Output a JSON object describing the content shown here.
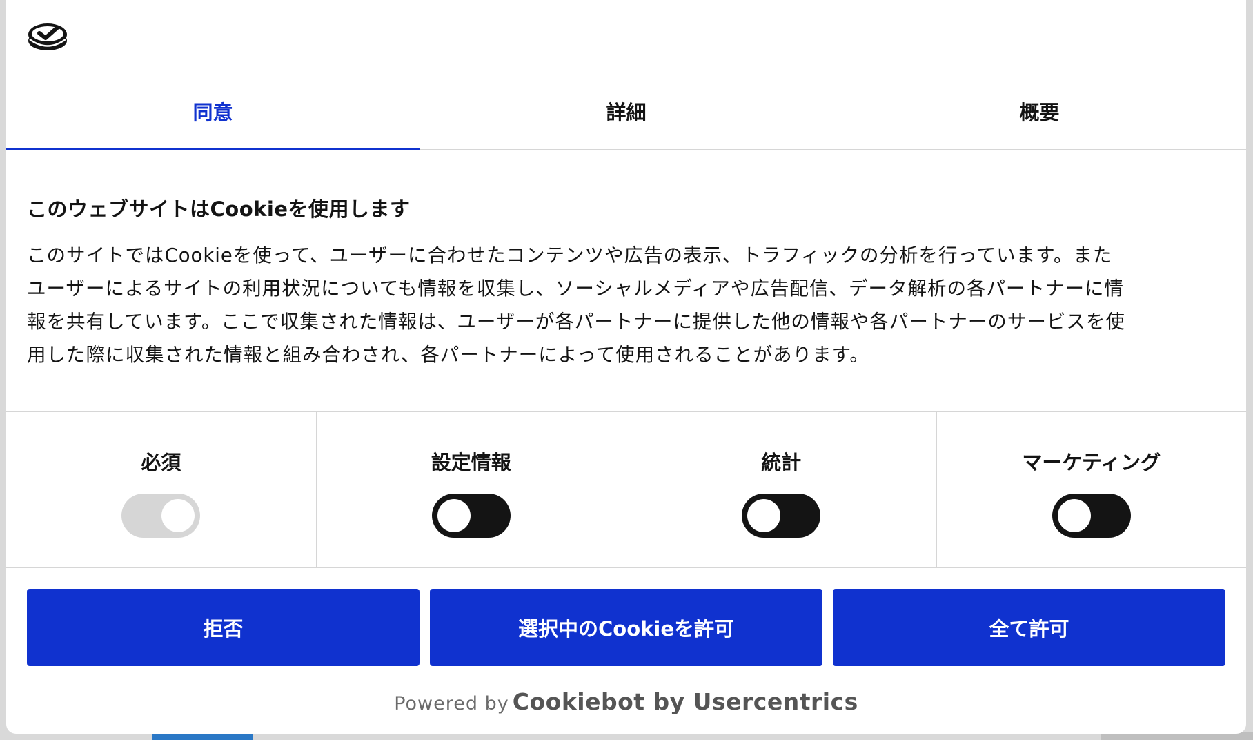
{
  "logo": {
    "icon": "cookiebot-logo-icon"
  },
  "tabs": [
    {
      "label": "同意",
      "active": true
    },
    {
      "label": "詳細",
      "active": false
    },
    {
      "label": "概要",
      "active": false
    }
  ],
  "consent": {
    "title": "このウェブサイトはCookieを使用します",
    "lines": [
      "このサイトではCookieを使って、ユーザーに合わせたコンテンツや広告の表示、トラフィックの分析を行っています。また",
      "ユーザーによるサイトの利用状況についても情報を収集し、ソーシャルメディアや広告配信、データ解析の各パートナーに情",
      "報を共有しています。ここで収集された情報は、ユーザーが各パートナーに提供した他の情報や各パートナーのサービスを使",
      "用した際に収集された情報と組み合わされ、各パートナーによって使用されることがあります。"
    ]
  },
  "categories": [
    {
      "label": "必須",
      "state": "on-disabled"
    },
    {
      "label": "設定情報",
      "state": "off"
    },
    {
      "label": "統計",
      "state": "off"
    },
    {
      "label": "マーケティング",
      "state": "off"
    }
  ],
  "buttons": {
    "deny": "拒否",
    "allow_selection": "選択中のCookieを許可",
    "allow_all": "全て許可"
  },
  "footer": {
    "powered_by": "Powered by",
    "brand": "Cookiebot by Usercentrics"
  },
  "colors": {
    "accent": "#1032cf",
    "toggle_off": "#141414",
    "toggle_disabled": "#d6d6d6"
  }
}
